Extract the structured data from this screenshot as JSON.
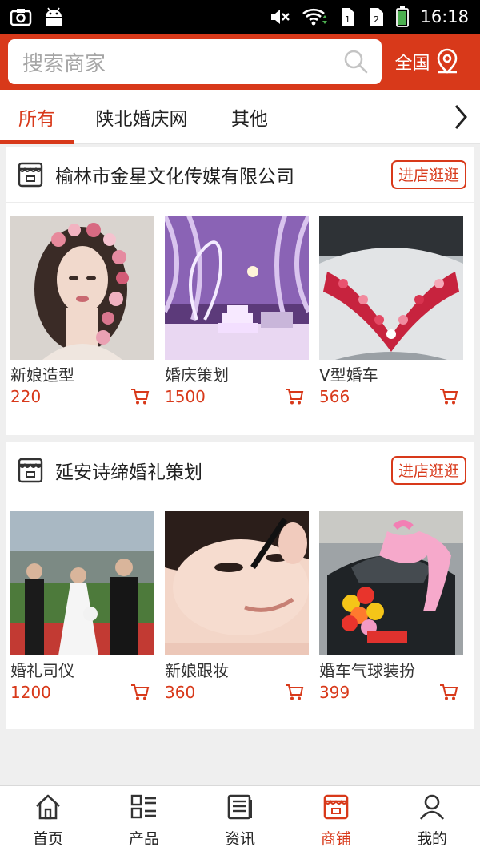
{
  "status_bar": {
    "time": "16:18"
  },
  "search": {
    "placeholder": "搜索商家",
    "region_label": "全国"
  },
  "tabs": [
    {
      "label": "所有",
      "active": true
    },
    {
      "label": "陕北婚庆网",
      "active": false
    },
    {
      "label": "其他",
      "active": false
    }
  ],
  "shops": [
    {
      "name": "榆林市金星文化传媒有限公司",
      "button_label": "进店逛逛",
      "products": [
        {
          "name": "新娘造型",
          "price": "220"
        },
        {
          "name": "婚庆策划",
          "price": "1500"
        },
        {
          "name": "V型婚车",
          "price": "566"
        }
      ]
    },
    {
      "name": "延安诗缔婚礼策划",
      "button_label": "进店逛逛",
      "products": [
        {
          "name": "婚礼司仪",
          "price": "1200"
        },
        {
          "name": "新娘跟妆",
          "price": "360"
        },
        {
          "name": "婚车气球装扮",
          "price": "399"
        }
      ]
    }
  ],
  "bottom_nav": [
    {
      "label": "首页",
      "icon": "home-icon",
      "active": false
    },
    {
      "label": "产品",
      "icon": "grid-list-icon",
      "active": false
    },
    {
      "label": "资讯",
      "icon": "news-icon",
      "active": false
    },
    {
      "label": "商铺",
      "icon": "store-icon",
      "active": true
    },
    {
      "label": "我的",
      "icon": "user-icon",
      "active": false
    }
  ],
  "colors": {
    "brand": "#d8391a",
    "background": "#efefef"
  }
}
